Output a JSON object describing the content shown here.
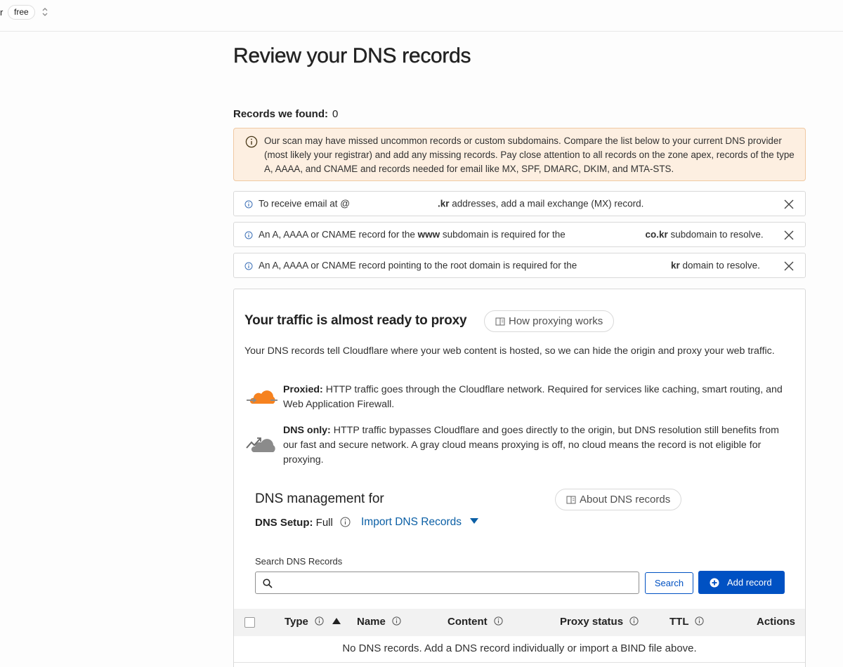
{
  "topbar": {
    "fragment": "r",
    "plan": "free",
    "colors": {
      "border": "#e8e8e8"
    }
  },
  "page": {
    "title": "Review your DNS records"
  },
  "records": {
    "label": "Records we found:",
    "count": "0"
  },
  "warning": {
    "text": "Our scan may have missed uncommon records or custom subdomains. Compare the list below to your current DNS provider (most likely your registrar) and add any missing records. Pay close attention to all records on the zone apex, records of the type A, AAAA, and CNAME and records needed for email like MX, SPF, DMARC, DKIM, and MTA-STS.",
    "icon": "info-circle-icon",
    "colors": {
      "bg": "#fdefe1",
      "border": "#f0c9a3"
    }
  },
  "notices": [
    {
      "pre": "To receive email at @",
      "bold": ".kr",
      "post": " addresses, add a mail exchange (MX) record."
    },
    {
      "pre": "An A, AAAA or CNAME record for the ",
      "bold1": "www",
      "mid": " subdomain is required for the ",
      "bold2": "co.kr",
      "post": " subdomain to resolve."
    },
    {
      "pre": "An A, AAAA or CNAME record pointing to the root domain is required for the ",
      "bold": "kr",
      "post": " domain to resolve."
    }
  ],
  "proxy": {
    "title": "Your traffic is almost ready to proxy",
    "how_button": "How proxying works",
    "description": "Your DNS records tell Cloudflare where your web content is hosted, so we can hide the origin and proxy your web traffic.",
    "proxied_label": "Proxied:",
    "proxied_text": " HTTP traffic goes through the Cloudflare network. Required for services like caching, smart routing, and Web Application Firewall.",
    "dnsonly_label": "DNS only:",
    "dnsonly_text": " HTTP traffic bypasses Cloudflare and goes directly to the origin, but DNS resolution still benefits from our fast and secure network. A gray cloud means proxying is off, no cloud means the record is not eligible for proxying.",
    "colors": {
      "orange": "#f6821f",
      "gray": "#8b8b8b"
    }
  },
  "management": {
    "title": "DNS management for",
    "about_button": "About DNS records",
    "setup_label": "DNS Setup:",
    "setup_value": "Full",
    "import_link": "Import DNS Records"
  },
  "search": {
    "label": "Search DNS Records",
    "placeholder": "",
    "value": "",
    "search_button": "Search",
    "add_button": "Add record",
    "colors": {
      "primary": "#0051c3",
      "link": "#0b5fa5"
    }
  },
  "table": {
    "columns": {
      "type": "Type",
      "name": "Name",
      "content": "Content",
      "proxy_status": "Proxy status",
      "ttl": "TTL",
      "actions": "Actions"
    },
    "sort": "ascending-by-type",
    "empty": "No DNS records. Add a DNS record individually or import a BIND file above."
  }
}
